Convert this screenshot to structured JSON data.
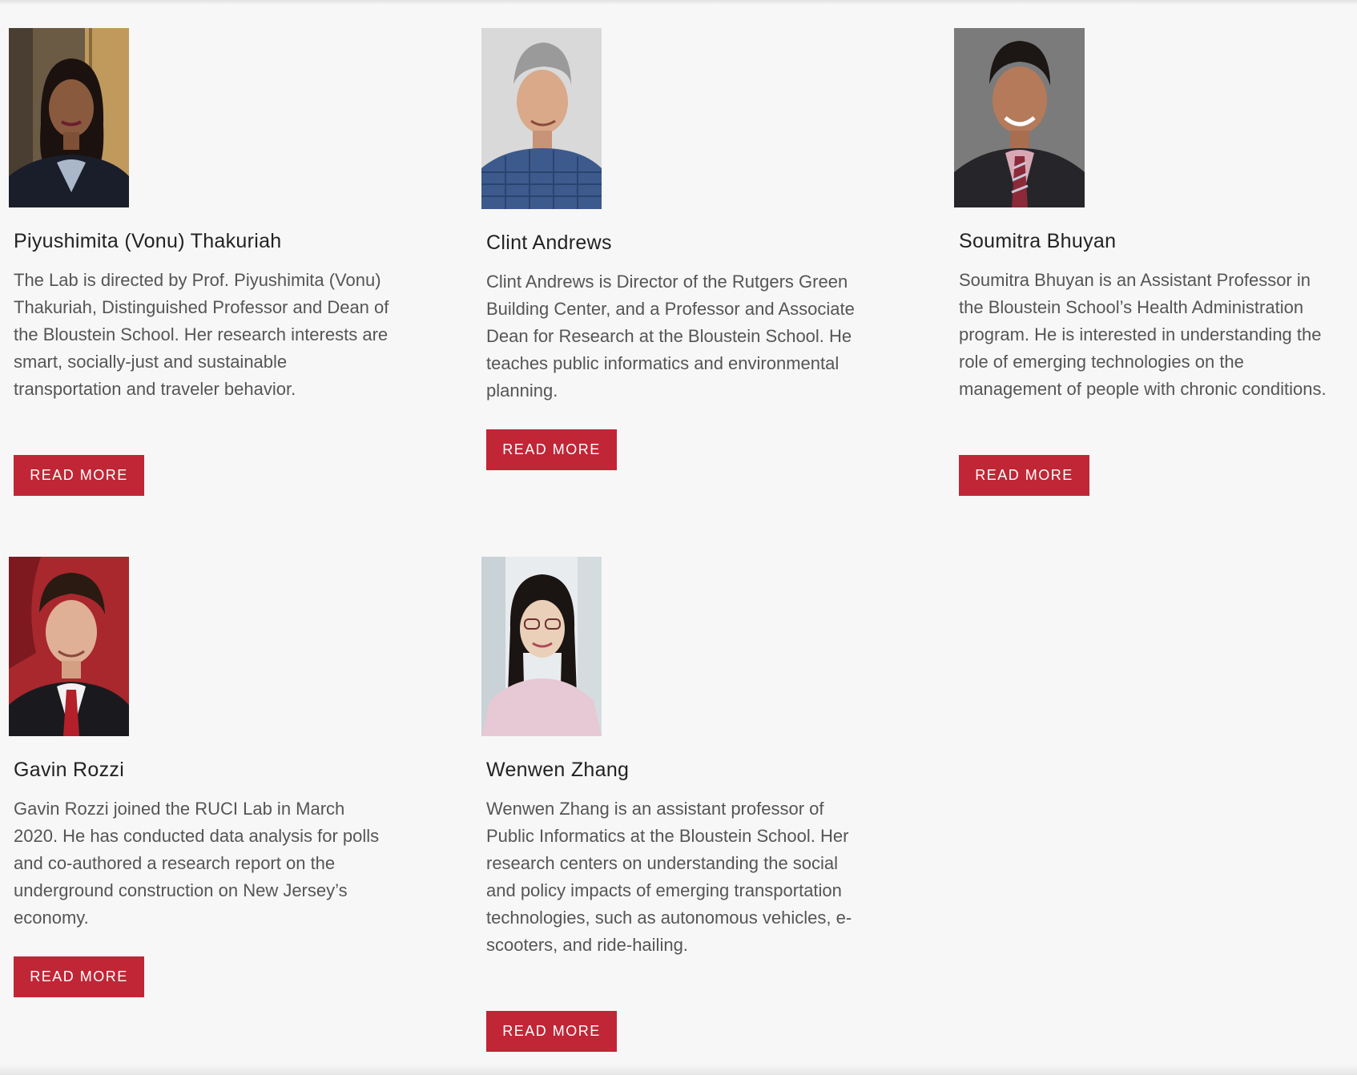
{
  "people": [
    {
      "photo_alt": "Piyushimita (Vonu) Thakuriah",
      "name": "Piyushimita (Vonu) Thakuriah",
      "bio": "The Lab is directed by Prof. Piyushimita (Vonu) Thakuriah, Distinguished Professor and Dean of the Bloustein School. Her research interests are smart, socially-just and sustainable transportation and traveler behavior.",
      "button": "READ MORE"
    },
    {
      "photo_alt": "Clint Andrews",
      "name": "Clint Andrews",
      "bio": "Clint Andrews is Director of the Rutgers Green Building Center, and a Professor and Associate Dean for Research at the Bloustein School. He teaches public informatics and environmental planning.",
      "button": "READ MORE"
    },
    {
      "photo_alt": "Soumitra Bhuyan",
      "name": "Soumitra Bhuyan",
      "bio": "Soumitra Bhuyan is an Assistant Professor in the Bloustein School’s Health Administration program. He is interested in understanding the role of emerging technologies on the management of people with chronic conditions.",
      "button": "READ MORE"
    },
    {
      "photo_alt": "Gavin Rozzi",
      "name": "Gavin Rozzi",
      "bio": "Gavin Rozzi joined the RUCI Lab in March 2020. He has conducted data analysis for polls and co-authored a research report on the underground construction on New Jersey’s economy.",
      "button": "READ MORE"
    },
    {
      "photo_alt": "Wenwen Zhang",
      "name": "Wenwen Zhang",
      "bio": "Wenwen Zhang is an assistant professor of Public Informatics at the Bloustein School. Her research centers on understanding the social and policy impacts of emerging transportation technologies, such as autonomous vehicles, e-scooters, and ride-hailing.",
      "button": "READ MORE"
    }
  ],
  "colors": {
    "accent": "#c02636",
    "background": "#f7f7f7",
    "body_text": "#555555",
    "heading_text": "#222222"
  }
}
